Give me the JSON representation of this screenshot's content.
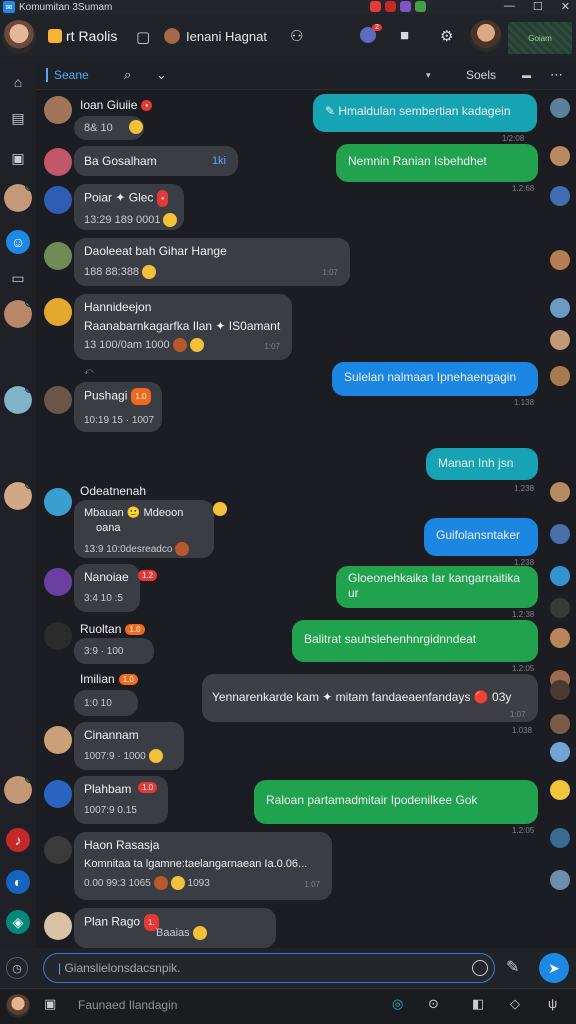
{
  "window": {
    "title": "Komumitan 3Sumam",
    "controls": [
      "—",
      "☐",
      "✕"
    ]
  },
  "header": {
    "title": "rt Raolis",
    "contact_name": "Ienani Hagnat",
    "map_label": "Goiam"
  },
  "toolbar": {
    "search_label": "Seane",
    "sort_label": "Soels"
  },
  "messages": [
    {
      "sender": "Ioan Giuiie",
      "tag": "•",
      "meta": "8& 10"
    },
    {
      "text": "Hmaldulan sembertian kadagein",
      "time": "1/2:08"
    },
    {
      "text": "Ba Gosalham",
      "badge": "1ki"
    },
    {
      "text": "Nemnin Ranian Isbehdhet",
      "time": "1.2:68"
    },
    {
      "sender": "Poiar ✦ Glec",
      "meta": "13:29 189 0001"
    },
    {
      "sender": "Daoleeat bah Gihar Hange",
      "meta": "188 88:388",
      "time": "1:07"
    },
    {
      "sender": "Hannideejon",
      "text": "Raanabarnkagarfka Ilan ✦ IS0amant",
      "meta": "13 100/0am 1000",
      "time": "1:07"
    },
    {
      "text": "Sulelan nalmaan Ipnehaengagin",
      "time": "1.138"
    },
    {
      "sender": "Pushagi",
      "tag": "1.0",
      "meta": "10:19 15 · 1007"
    },
    {
      "text": "Manan Inh jsn",
      "time": "1.238"
    },
    {
      "sender": "Odeatnenah",
      "text": "Mbauan 🙂 Mdeoon",
      "text2": "oana",
      "meta": "13:9 10:0desreadco"
    },
    {
      "text": "Guifolansntaker",
      "time": "1.238"
    },
    {
      "sender": "Nanoiae",
      "tag": "1.2",
      "meta": "3:4 10 :5"
    },
    {
      "text": "Gloeonehkaika Iar kangarnaitika",
      "text2": "ur",
      "time": "1.2:38"
    },
    {
      "sender": "Ruoltan",
      "tag": "1.0",
      "meta": "3:9 · 100"
    },
    {
      "text": "Balitrat sauhslehenhnrgidnndeat",
      "time": "1.2:05"
    },
    {
      "sender": "Imilian",
      "tag": "1.0",
      "meta": "1:0 10"
    },
    {
      "text": "Yennarenkarde kam ✦ mitam fandaeaenfandays 🔴 03y",
      "time": "1:07"
    },
    {
      "sender": "Cinannam",
      "meta": "1007:9 · 1000",
      "time": "1.038"
    },
    {
      "sender": "Plahbam",
      "tag": "1.0",
      "meta": "1007:9 0.15"
    },
    {
      "text": "Raloan partamadmitair Ipodenilkee Gok",
      "time": "1.2:05"
    },
    {
      "sender": "Haon Rasasja",
      "text": "Komnitaa ta lgamne:taelangarnaean Ia.0.06...",
      "meta": "0.00 99:3 1065",
      "meta2": "1093",
      "time": "1:07"
    },
    {
      "sender": "Plan Rago",
      "tag": "1.",
      "meta": "Baaias"
    }
  ],
  "composer": {
    "placeholder": "Gianslielonsdacsnpik."
  },
  "bottombar": {
    "input": "Faunaed Ilandagin"
  },
  "colors": {
    "accent": "#1e88e5",
    "bubble_in": "#3a3d44",
    "bubble_teal": "#16a3b3",
    "bubble_green": "#21a24f",
    "bubble_blue": "#1c86e3",
    "tag_red": "#e53935",
    "tag_orange": "#f06a1d"
  }
}
